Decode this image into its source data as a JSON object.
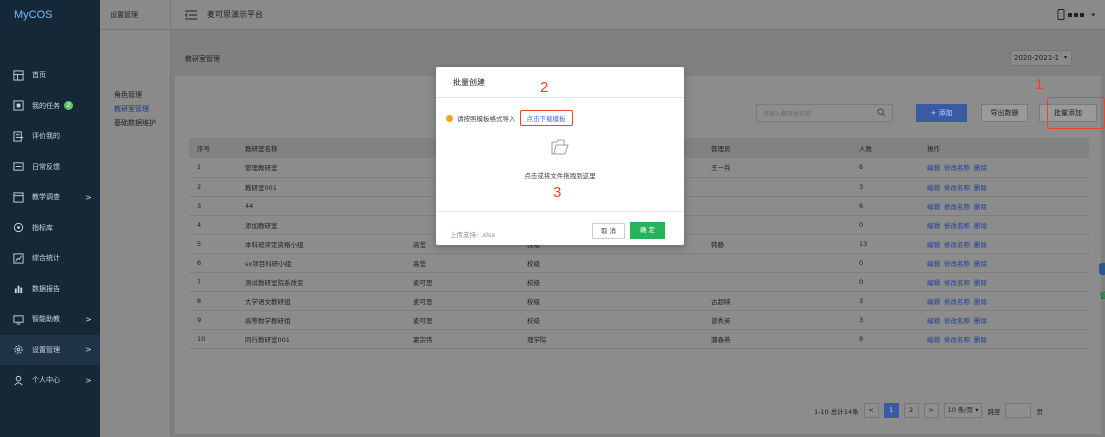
{
  "app": {
    "logo": "MyCOS",
    "header_title": "麦可思演示平台"
  },
  "nav": {
    "items": [
      {
        "label": "首页",
        "icon": "dashboard-icon"
      },
      {
        "label": "我的任务",
        "icon": "task-icon",
        "badge": "2"
      },
      {
        "label": "评价我的",
        "icon": "evaluate-icon"
      },
      {
        "label": "日常反馈",
        "icon": "feedback-icon"
      },
      {
        "label": "教学调查",
        "icon": "survey-icon",
        "chevron": ">"
      },
      {
        "label": "指标库",
        "icon": "indicator-icon"
      },
      {
        "label": "综合统计",
        "icon": "statistics-icon"
      },
      {
        "label": "数据报告",
        "icon": "report-icon"
      },
      {
        "label": "智能助教",
        "icon": "assistant-icon",
        "chevron": ">"
      },
      {
        "label": "设置管理",
        "icon": "settings-icon",
        "chevron": ">"
      },
      {
        "label": "个人中心",
        "icon": "user-icon",
        "chevron": ">"
      }
    ]
  },
  "submenu": {
    "head": "设置管理",
    "items": [
      "角色管理",
      "教研室管理",
      "基础数据维护"
    ]
  },
  "breadcrumb": "教研室管理",
  "term": "2020-2021-1",
  "toolbar": {
    "search_placeholder": "请输入教研室名称",
    "add": "+ 添加",
    "export": "导出数据",
    "batch_add": "批量添加"
  },
  "table": {
    "headers": [
      "序号",
      "教研室名称",
      "",
      "",
      "管理员",
      "人数",
      "操作"
    ],
    "rows": [
      [
        "1",
        "管理教研室",
        "",
        "",
        "王一兵",
        "6"
      ],
      [
        "2",
        "教研室001",
        "",
        "",
        "",
        "3"
      ],
      [
        "3",
        "44",
        "",
        "",
        "",
        "6"
      ],
      [
        "4",
        "添加教研室",
        "",
        "",
        "",
        "0"
      ],
      [
        "5",
        "本科班评定资格小组",
        "高莹",
        "校级",
        "韩静",
        "13"
      ],
      [
        "6",
        "sx项目科研小组",
        "高莹",
        "校级",
        "",
        "0"
      ],
      [
        "7",
        "测试教研室院系改变",
        "麦可思",
        "校级",
        "",
        "0"
      ],
      [
        "8",
        "大学语文教研组",
        "麦可思",
        "校级",
        "古超映",
        "3"
      ],
      [
        "9",
        "高等数学教研组",
        "麦可思",
        "校级",
        "曾秀英",
        "3"
      ],
      [
        "10",
        "同行教研室001",
        "夏宗伟",
        "理学院",
        "蒲春燕",
        "8"
      ]
    ],
    "ops": [
      "编辑",
      "修改名称",
      "删除"
    ]
  },
  "pager": {
    "total": "1-10 总计14条",
    "prev": "<",
    "pages": [
      "1",
      "2"
    ],
    "next": ">",
    "size": "10 条/页",
    "goto": "跳至",
    "page_unit": "页"
  },
  "modal": {
    "title": "批量创建",
    "hint": "请按照模板格式导入",
    "download": "点击下载模板",
    "drop": "点击或将文件拖拽到这里",
    "support": "上传支持: .xlsx",
    "cancel": "取 消",
    "ok": "确 定"
  },
  "annotations": {
    "n1": "1",
    "n2": "2",
    "n3": "3"
  },
  "colors": {
    "accent": "#3a5aa6",
    "annotation": "#e5472a",
    "confirm": "#27b35a",
    "nav_bg": "#152838"
  }
}
